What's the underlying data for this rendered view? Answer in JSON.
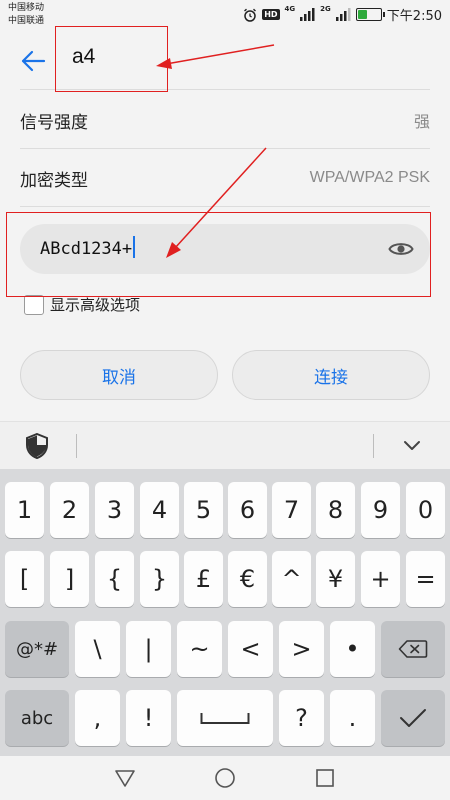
{
  "status_bar": {
    "carrier_1": "中国移动",
    "carrier_2": "中国联通",
    "hd_badge": "HD",
    "network_1": "4G",
    "network_2": "2G",
    "time": "下午2:50",
    "battery_level": 0.45,
    "battery_color": "#2eaa3c"
  },
  "app_bar": {
    "back_icon": "arrow-left-icon",
    "ssid": "a4"
  },
  "details": [
    {
      "label": "信号强度",
      "value": "强"
    },
    {
      "label": "加密类型",
      "value": "WPA/WPA2 PSK"
    }
  ],
  "password": {
    "value": "ABcd1234+",
    "toggle_icon": "eye-icon"
  },
  "advanced_option": {
    "label": "显示高级选项",
    "checked": false
  },
  "buttons": {
    "cancel": "取消",
    "connect": "连接"
  },
  "keyboard_toolbar": {
    "shield_icon": "shield-icon",
    "collapse_icon": "chevron-down-icon"
  },
  "keyboard": {
    "row1": [
      "1",
      "2",
      "3",
      "4",
      "5",
      "6",
      "7",
      "8",
      "9",
      "0"
    ],
    "row2": [
      "[",
      "]",
      "{",
      "}",
      "£",
      "€",
      "^",
      "¥",
      "+",
      "="
    ],
    "row3": [
      "@*#",
      "\\",
      "|",
      "~",
      "<",
      ">",
      "•",
      "backspace-icon"
    ],
    "row4": [
      "abc",
      ",",
      "!",
      "space-icon",
      "?",
      ".",
      "enter-check-icon"
    ]
  },
  "nav_bar": {
    "back": "triangle-back-icon",
    "home": "circle-home-icon",
    "recents": "square-recents-icon"
  },
  "colors": {
    "accent": "#1a73e8",
    "annotation": "#e02020"
  }
}
